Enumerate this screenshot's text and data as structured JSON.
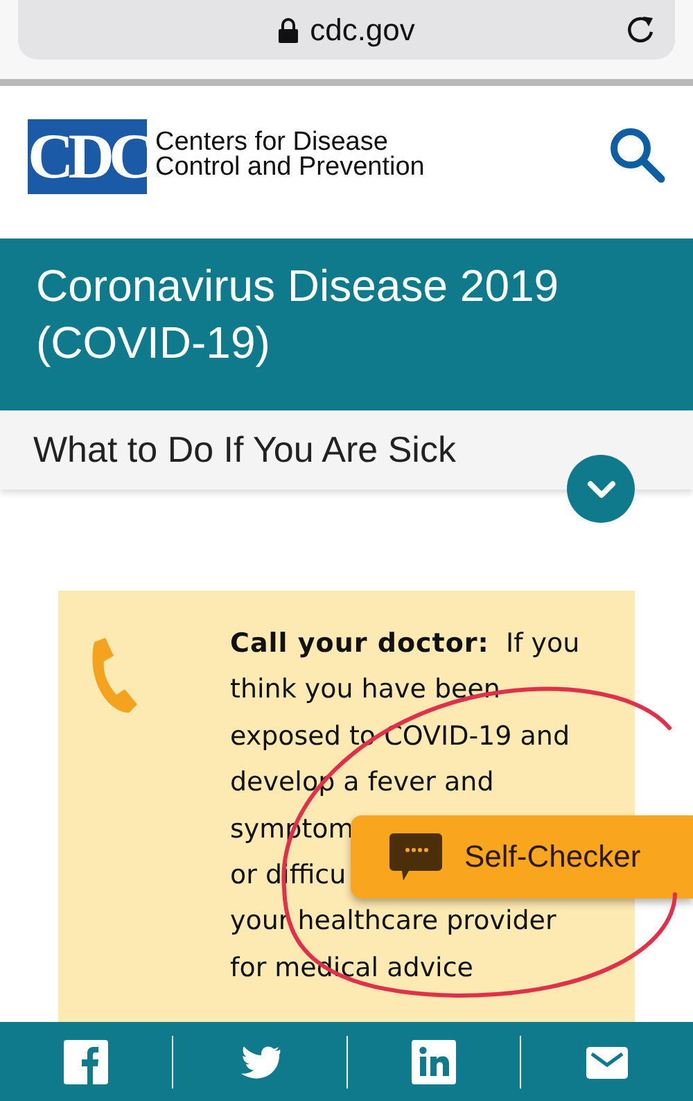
{
  "browser": {
    "url": "cdc.gov",
    "secure": true
  },
  "header": {
    "logo_text": "CDC",
    "org_name": "Centers for Disease\nControl and Prevention"
  },
  "banner": {
    "title": "Coronavirus Disease 2019 (COVID-19)"
  },
  "section": {
    "title": "What to Do If You Are Sick",
    "expanded": false
  },
  "card": {
    "lines": [
      "**Call your doctor:**  If you",
      "think you have been",
      "exposed to COVID-19 and",
      "develop a fever and",
      "symptom",
      "or difficu",
      "your healthcare provider",
      "for medical advice"
    ]
  },
  "self_checker": {
    "label": "Self-Checker"
  },
  "share": [
    {
      "kind": "facebook"
    },
    {
      "kind": "twitter"
    },
    {
      "kind": "linkedin"
    },
    {
      "kind": "email"
    }
  ]
}
